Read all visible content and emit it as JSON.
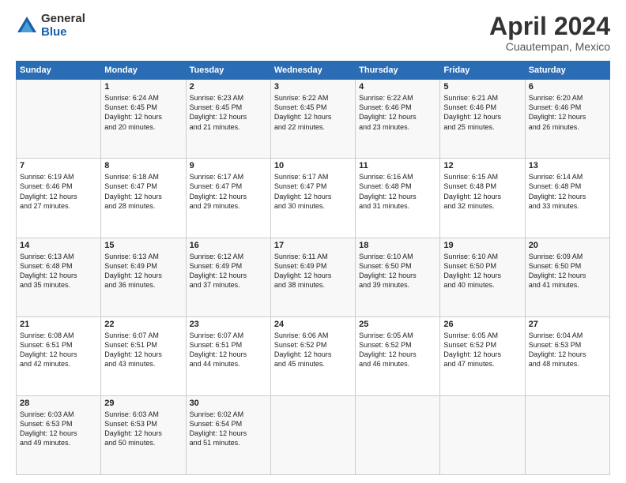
{
  "logo": {
    "general": "General",
    "blue": "Blue"
  },
  "title": "April 2024",
  "subtitle": "Cuautempan, Mexico",
  "headers": [
    "Sunday",
    "Monday",
    "Tuesday",
    "Wednesday",
    "Thursday",
    "Friday",
    "Saturday"
  ],
  "weeks": [
    [
      {
        "day": "",
        "info": ""
      },
      {
        "day": "1",
        "info": "Sunrise: 6:24 AM\nSunset: 6:45 PM\nDaylight: 12 hours\nand 20 minutes."
      },
      {
        "day": "2",
        "info": "Sunrise: 6:23 AM\nSunset: 6:45 PM\nDaylight: 12 hours\nand 21 minutes."
      },
      {
        "day": "3",
        "info": "Sunrise: 6:22 AM\nSunset: 6:45 PM\nDaylight: 12 hours\nand 22 minutes."
      },
      {
        "day": "4",
        "info": "Sunrise: 6:22 AM\nSunset: 6:46 PM\nDaylight: 12 hours\nand 23 minutes."
      },
      {
        "day": "5",
        "info": "Sunrise: 6:21 AM\nSunset: 6:46 PM\nDaylight: 12 hours\nand 25 minutes."
      },
      {
        "day": "6",
        "info": "Sunrise: 6:20 AM\nSunset: 6:46 PM\nDaylight: 12 hours\nand 26 minutes."
      }
    ],
    [
      {
        "day": "7",
        "info": "Sunrise: 6:19 AM\nSunset: 6:46 PM\nDaylight: 12 hours\nand 27 minutes."
      },
      {
        "day": "8",
        "info": "Sunrise: 6:18 AM\nSunset: 6:47 PM\nDaylight: 12 hours\nand 28 minutes."
      },
      {
        "day": "9",
        "info": "Sunrise: 6:17 AM\nSunset: 6:47 PM\nDaylight: 12 hours\nand 29 minutes."
      },
      {
        "day": "10",
        "info": "Sunrise: 6:17 AM\nSunset: 6:47 PM\nDaylight: 12 hours\nand 30 minutes."
      },
      {
        "day": "11",
        "info": "Sunrise: 6:16 AM\nSunset: 6:48 PM\nDaylight: 12 hours\nand 31 minutes."
      },
      {
        "day": "12",
        "info": "Sunrise: 6:15 AM\nSunset: 6:48 PM\nDaylight: 12 hours\nand 32 minutes."
      },
      {
        "day": "13",
        "info": "Sunrise: 6:14 AM\nSunset: 6:48 PM\nDaylight: 12 hours\nand 33 minutes."
      }
    ],
    [
      {
        "day": "14",
        "info": "Sunrise: 6:13 AM\nSunset: 6:48 PM\nDaylight: 12 hours\nand 35 minutes."
      },
      {
        "day": "15",
        "info": "Sunrise: 6:13 AM\nSunset: 6:49 PM\nDaylight: 12 hours\nand 36 minutes."
      },
      {
        "day": "16",
        "info": "Sunrise: 6:12 AM\nSunset: 6:49 PM\nDaylight: 12 hours\nand 37 minutes."
      },
      {
        "day": "17",
        "info": "Sunrise: 6:11 AM\nSunset: 6:49 PM\nDaylight: 12 hours\nand 38 minutes."
      },
      {
        "day": "18",
        "info": "Sunrise: 6:10 AM\nSunset: 6:50 PM\nDaylight: 12 hours\nand 39 minutes."
      },
      {
        "day": "19",
        "info": "Sunrise: 6:10 AM\nSunset: 6:50 PM\nDaylight: 12 hours\nand 40 minutes."
      },
      {
        "day": "20",
        "info": "Sunrise: 6:09 AM\nSunset: 6:50 PM\nDaylight: 12 hours\nand 41 minutes."
      }
    ],
    [
      {
        "day": "21",
        "info": "Sunrise: 6:08 AM\nSunset: 6:51 PM\nDaylight: 12 hours\nand 42 minutes."
      },
      {
        "day": "22",
        "info": "Sunrise: 6:07 AM\nSunset: 6:51 PM\nDaylight: 12 hours\nand 43 minutes."
      },
      {
        "day": "23",
        "info": "Sunrise: 6:07 AM\nSunset: 6:51 PM\nDaylight: 12 hours\nand 44 minutes."
      },
      {
        "day": "24",
        "info": "Sunrise: 6:06 AM\nSunset: 6:52 PM\nDaylight: 12 hours\nand 45 minutes."
      },
      {
        "day": "25",
        "info": "Sunrise: 6:05 AM\nSunset: 6:52 PM\nDaylight: 12 hours\nand 46 minutes."
      },
      {
        "day": "26",
        "info": "Sunrise: 6:05 AM\nSunset: 6:52 PM\nDaylight: 12 hours\nand 47 minutes."
      },
      {
        "day": "27",
        "info": "Sunrise: 6:04 AM\nSunset: 6:53 PM\nDaylight: 12 hours\nand 48 minutes."
      }
    ],
    [
      {
        "day": "28",
        "info": "Sunrise: 6:03 AM\nSunset: 6:53 PM\nDaylight: 12 hours\nand 49 minutes."
      },
      {
        "day": "29",
        "info": "Sunrise: 6:03 AM\nSunset: 6:53 PM\nDaylight: 12 hours\nand 50 minutes."
      },
      {
        "day": "30",
        "info": "Sunrise: 6:02 AM\nSunset: 6:54 PM\nDaylight: 12 hours\nand 51 minutes."
      },
      {
        "day": "",
        "info": ""
      },
      {
        "day": "",
        "info": ""
      },
      {
        "day": "",
        "info": ""
      },
      {
        "day": "",
        "info": ""
      }
    ]
  ]
}
